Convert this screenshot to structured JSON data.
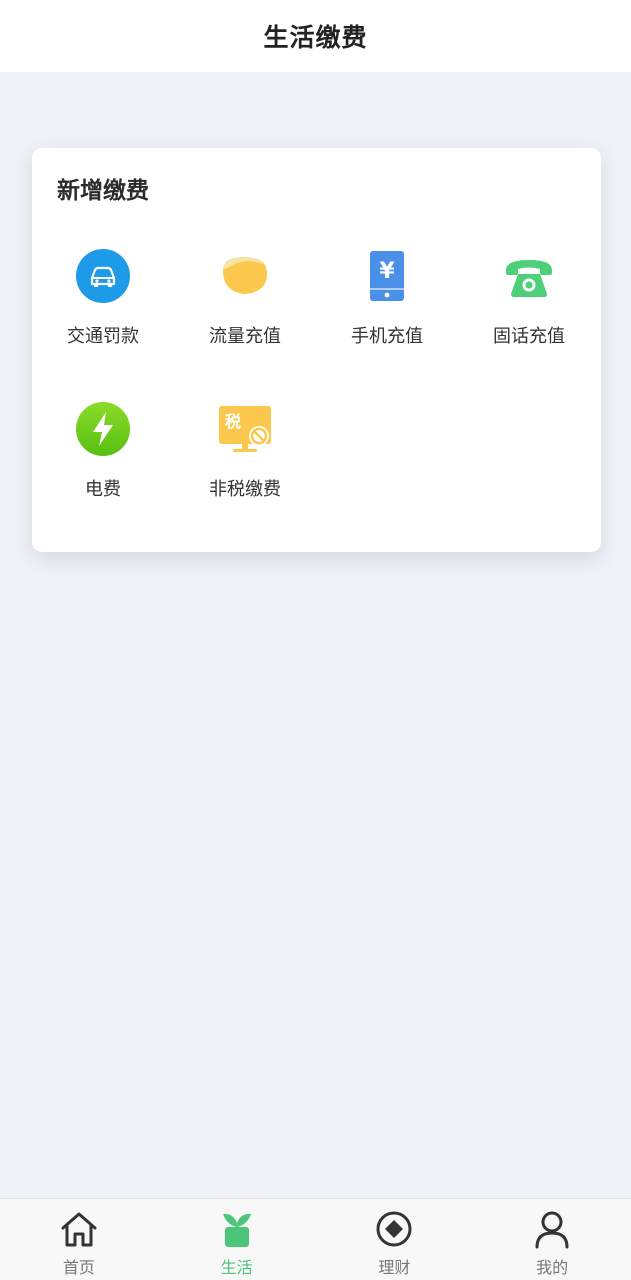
{
  "header": {
    "title": "生活缴费"
  },
  "card": {
    "title": "新增缴费",
    "items": [
      {
        "label": "交通罚款",
        "icon": "car-icon",
        "color": "#1e9be8"
      },
      {
        "label": "流量充值",
        "icon": "data-flow-icon",
        "color": "#fbc84d"
      },
      {
        "label": "手机充值",
        "icon": "phone-recharge-icon",
        "color": "#4a90e8"
      },
      {
        "label": "固话充值",
        "icon": "telephone-icon",
        "color": "#4ed07a"
      },
      {
        "label": "电费",
        "icon": "lightning-icon",
        "color": "#6fcf1e"
      },
      {
        "label": "非税缴费",
        "icon": "non-tax-icon",
        "color": "#fbc84d",
        "badge": "税"
      }
    ]
  },
  "tabbar": {
    "tabs": [
      {
        "label": "首页",
        "icon": "home-icon"
      },
      {
        "label": "生活",
        "icon": "sprout-icon",
        "active": true
      },
      {
        "label": "理财",
        "icon": "finance-icon"
      },
      {
        "label": "我的",
        "icon": "user-icon"
      }
    ],
    "active_color": "#4cc67a"
  }
}
